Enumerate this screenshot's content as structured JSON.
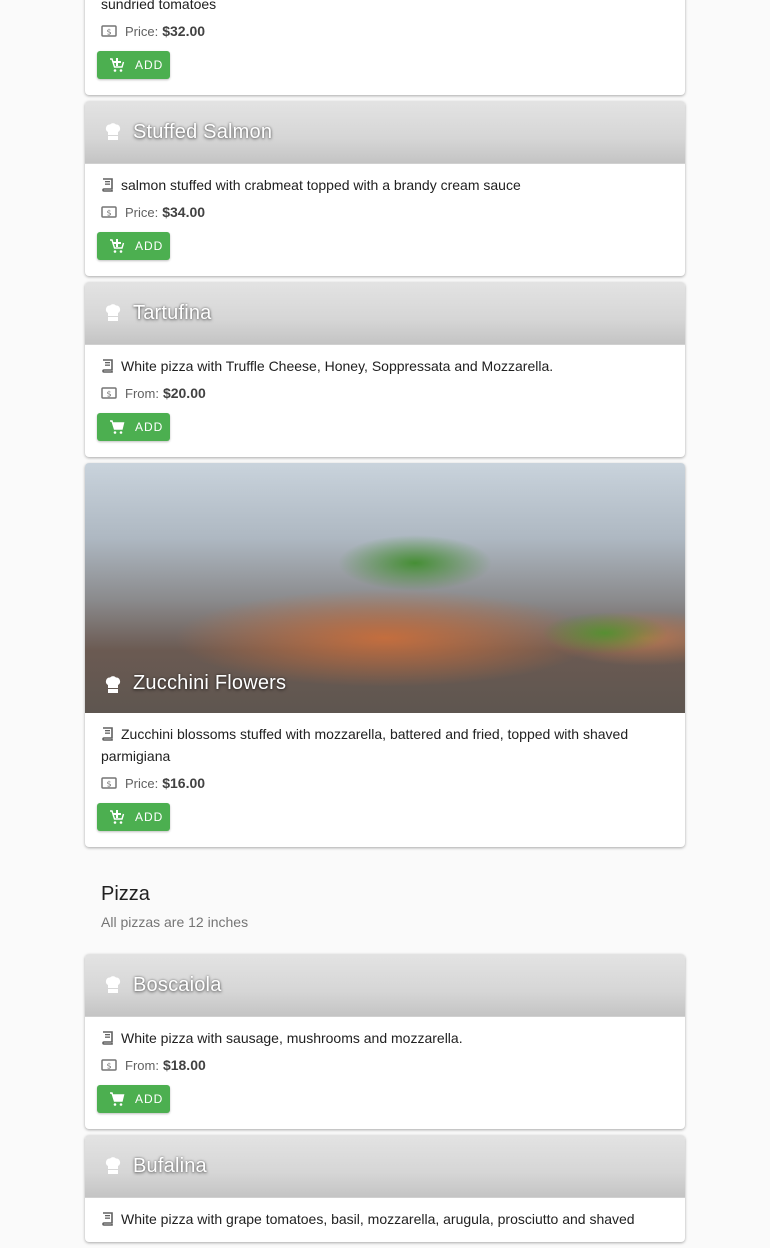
{
  "add_label": "ADD",
  "accent": "#4caf50",
  "icons": {
    "title": "chef-hat-icon",
    "description": "menu-book-icon",
    "price": "money-icon",
    "add": "add-cart-icon"
  },
  "items_top": [
    {
      "name": "",
      "description": "sundried tomatoes",
      "price_label": "Price:",
      "price": "$32.00",
      "partial": true
    },
    {
      "name": "Stuffed Salmon",
      "description": "salmon stuffed with crabmeat topped with a brandy cream sauce",
      "price_label": "Price:",
      "price": "$34.00"
    },
    {
      "name": "Tartufina",
      "description": "White pizza with Truffle Cheese, Honey, Soppressata and Mozzarella.",
      "price_label": "From:",
      "price": "$20.00"
    },
    {
      "name": "Zucchini Flowers",
      "description": "Zucchini blossoms stuffed with mozzarella, battered and fried, topped with shaved parmigiana",
      "price_label": "Price:",
      "price": "$16.00",
      "image": true
    }
  ],
  "section": {
    "title": "Pizza",
    "subtitle": "All pizzas are 12 inches"
  },
  "items_pizza": [
    {
      "name": "Boscaiola",
      "description": "White pizza with sausage, mushrooms and mozzarella.",
      "price_label": "From:",
      "price": "$18.00"
    },
    {
      "name": "Bufalina",
      "description": "White pizza with grape tomatoes, basil, mozzarella, arugula, prosciutto and shaved",
      "price_label": "",
      "price": ""
    }
  ]
}
